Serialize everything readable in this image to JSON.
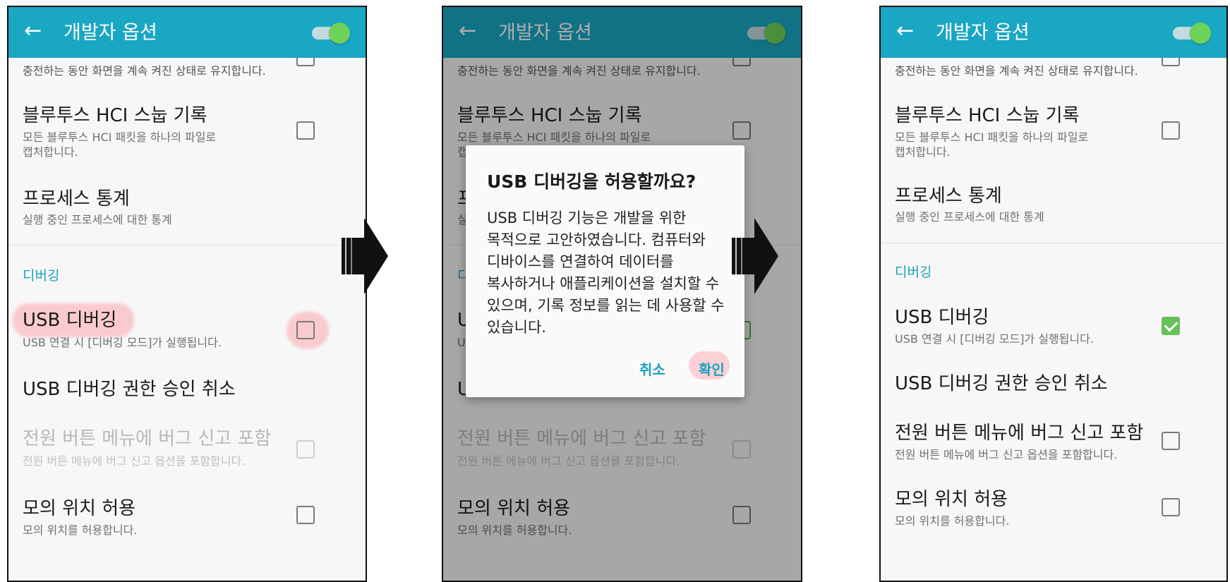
{
  "appbar": {
    "back_glyph": "←",
    "title": "개발자 옵션",
    "master_toggle": "on"
  },
  "settings": {
    "stay_awake_sub": "충전하는 동안 화면을 계속 켜진 상태로 유지합니다.",
    "bt_hci_title": "블루투스 HCI 스눕 기록",
    "bt_hci_sub_line1": "모든 블루투스 HCI 패킷을 하나의 파일로",
    "bt_hci_sub_line2": "캡처합니다.",
    "process_stats_title": "프로세스 통계",
    "process_stats_sub": "실행 중인 프로세스에 대한 통계",
    "debug_section": "디버깅",
    "usb_debug_title": "USB 디버깅",
    "usb_debug_sub": "USB 연결 시 [디버깅 모드]가 실행됩니다.",
    "usb_revoke_title": "USB 디버깅 권한 승인 취소",
    "bug_report_title": "전원 버튼 메뉴에 버그 신고 포함",
    "bug_report_sub": "전원 버튼 메뉴에 버그 신고 옵션을 포함합니다.",
    "mock_location_title": "모의 위치 허용",
    "mock_location_sub": "모의 위치를 허용합니다."
  },
  "dialog": {
    "title": "USB 디버깅을 허용할까요?",
    "body": "USB 디버깅 기능은 개발을 위한\n목적으로 고안하였습니다. 컴퓨터와\n디바이스를 연결하여 데이터를\n복사하거나 애플리케이션을 설치할 수\n있으며, 기록 정보를 읽는 데 사용할 수\n있습니다.",
    "cancel": "취소",
    "ok": "확인"
  },
  "screens": [
    {
      "step": 1,
      "usb_debugging_checked": false
    },
    {
      "step": 2,
      "usb_debugging_checked": false,
      "dialog_visible": true
    },
    {
      "step": 3,
      "usb_debugging_checked": true
    }
  ],
  "colors": {
    "appbar": "#1aa7c4",
    "accent": "#19a2bf",
    "toggle_thumb": "#6fd259",
    "checkbox_checked": "#68c158",
    "highlight": "#ff7882"
  },
  "icons": {
    "back": "arrow-left-icon",
    "step_arrow": "arrow-right-icon"
  }
}
